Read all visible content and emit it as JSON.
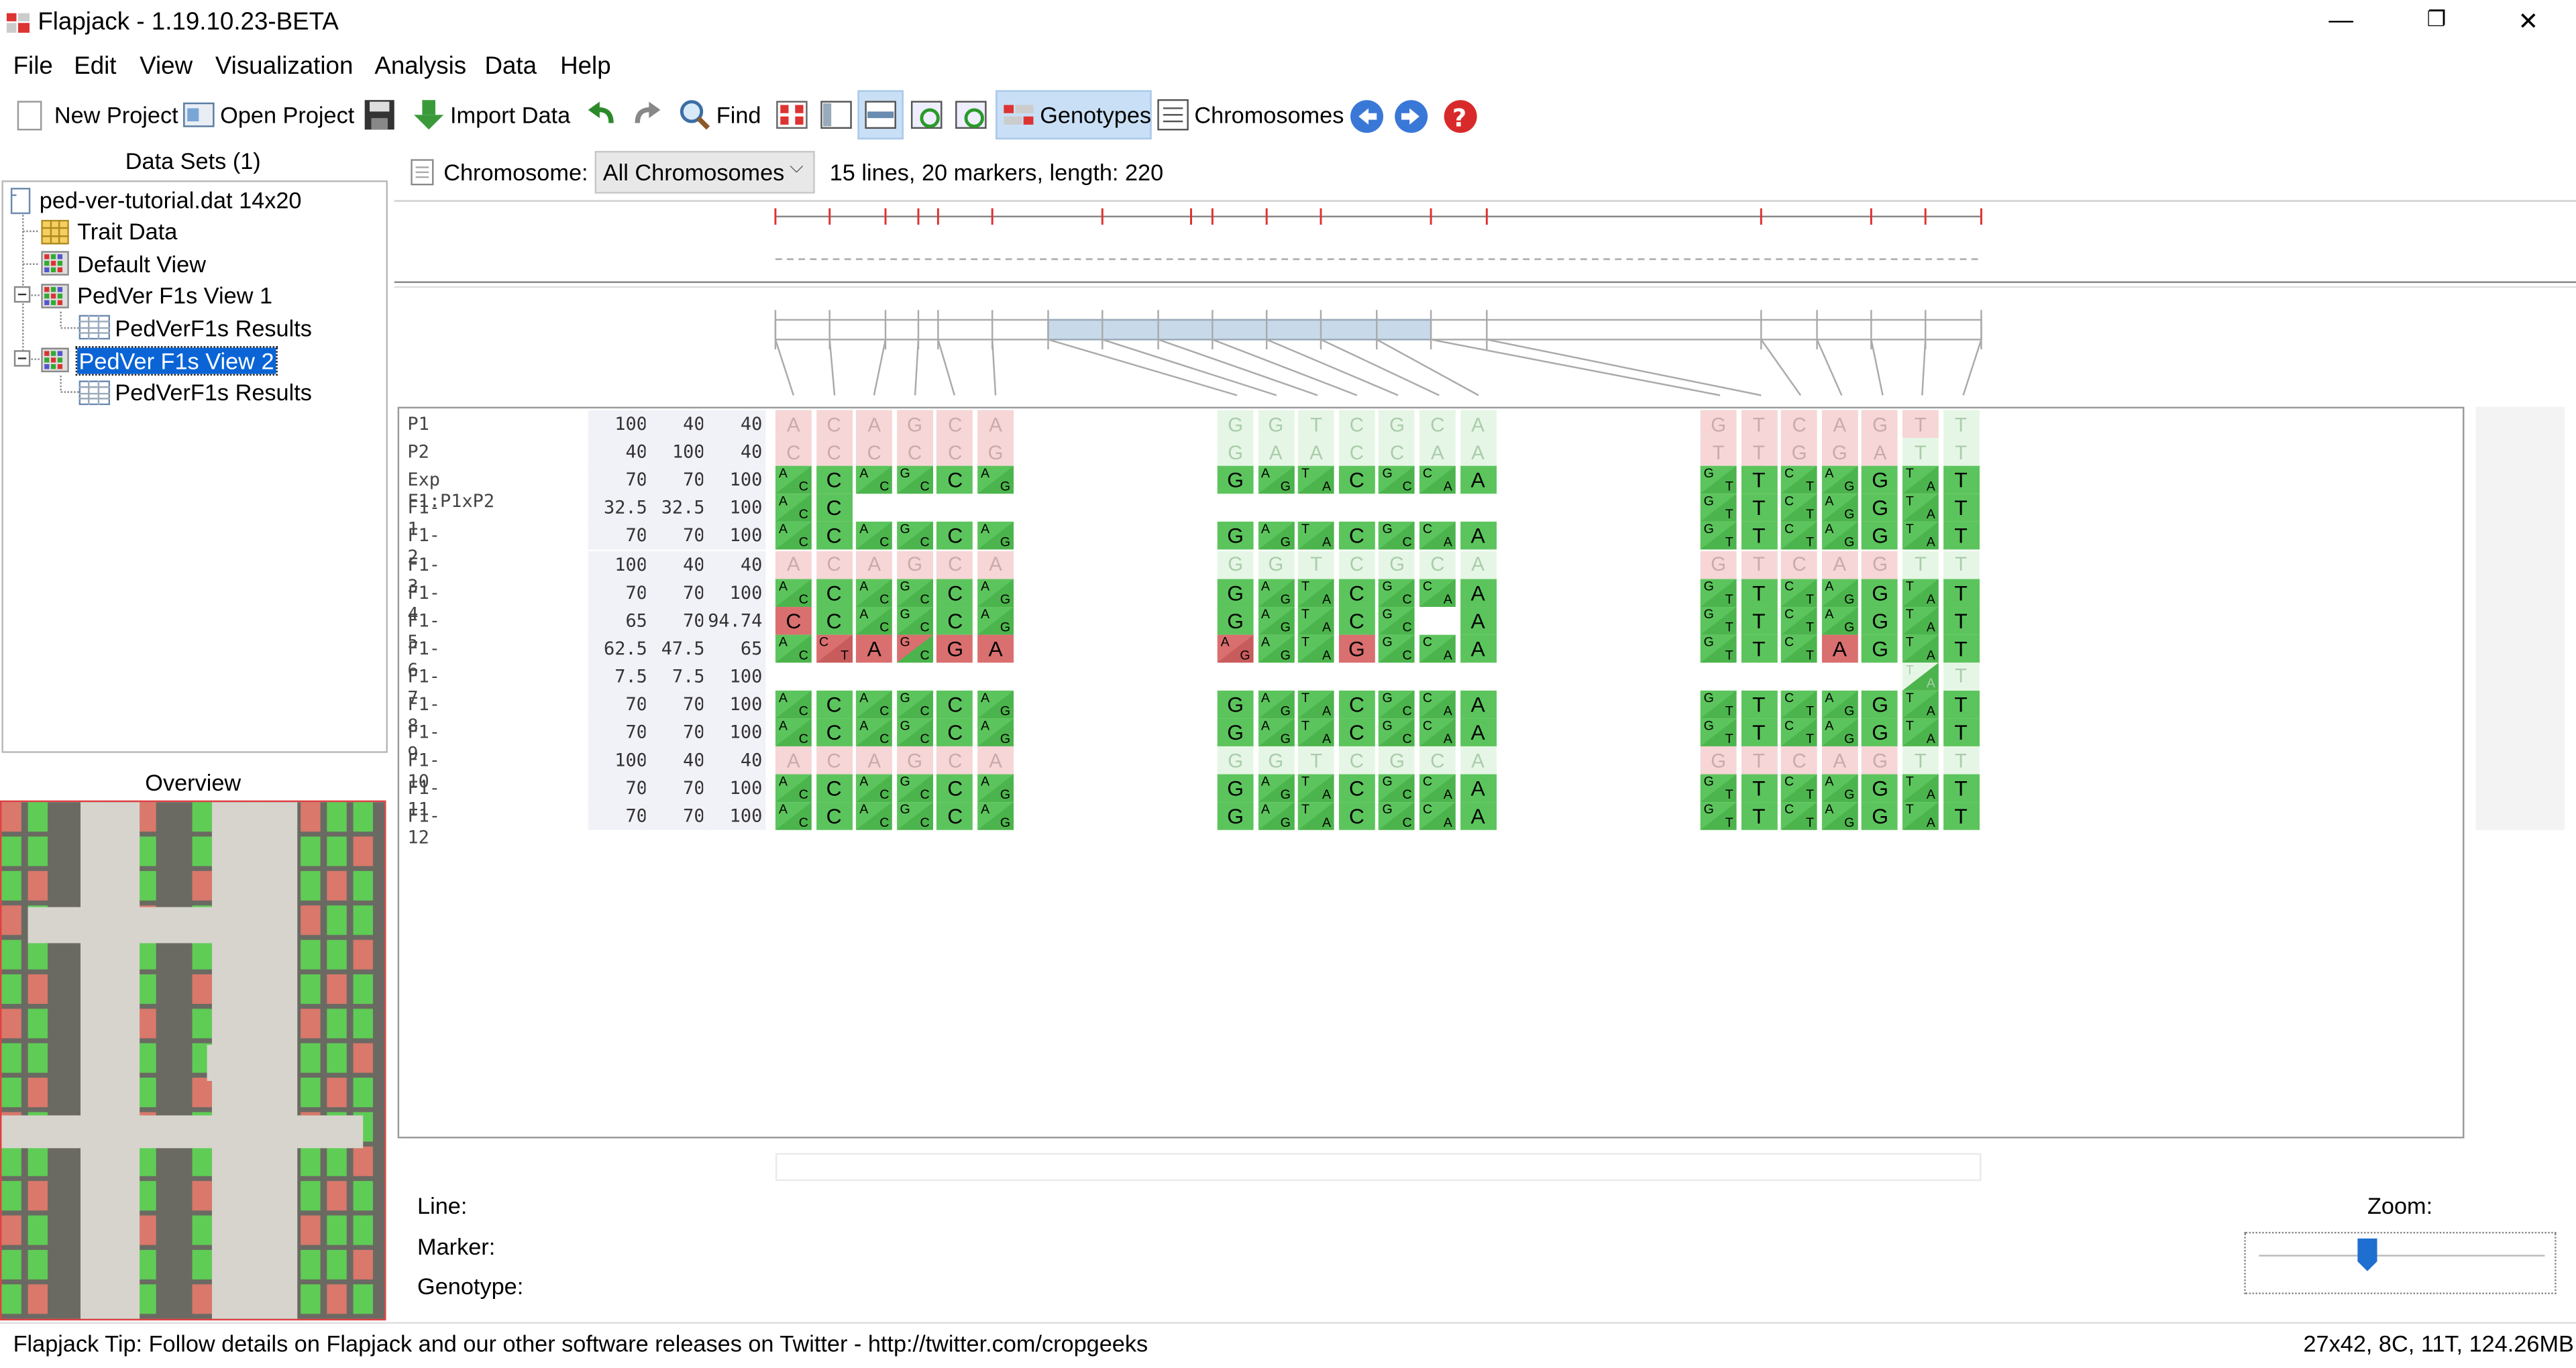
{
  "window": {
    "title": "Flapjack - 1.19.10.23-BETA",
    "minimize": "—",
    "restore": "❐",
    "close": "✕"
  },
  "menu": [
    "File",
    "Edit",
    "View",
    "Visualization",
    "Analysis",
    "Data",
    "Help"
  ],
  "toolbar": {
    "new_project": "New Project",
    "open_project": "Open Project",
    "import_data": "Import Data",
    "find": "Find",
    "genotypes": "Genotypes",
    "chromosomes": "Chromosomes"
  },
  "datasets": {
    "header": "Data Sets (1)",
    "items": [
      {
        "label": "ped-ver-tutorial.dat 14x20",
        "level": 0,
        "icon": "document-icon"
      },
      {
        "label": "Trait Data",
        "level": 1,
        "icon": "table-icon"
      },
      {
        "label": "Default View",
        "level": 1,
        "icon": "view-icon"
      },
      {
        "label": "PedVer F1s View 1",
        "level": 1,
        "icon": "view-icon"
      },
      {
        "label": "PedVerF1s Results",
        "level": 2,
        "icon": "results-icon"
      },
      {
        "label": "PedVer F1s View 2",
        "level": 1,
        "icon": "view-icon",
        "selected": true
      },
      {
        "label": "PedVerF1s Results",
        "level": 2,
        "icon": "results-icon"
      }
    ]
  },
  "overview": {
    "header": "Overview"
  },
  "chromosome_bar": {
    "label": "Chromosome:",
    "selected": "All Chromosomes",
    "summary": "15 lines, 20 markers, length: 220"
  },
  "genotype_table": {
    "rows": [
      {
        "name": "P1",
        "s1": "100",
        "s2": "40",
        "s3": "40"
      },
      {
        "name": "P2",
        "s1": "40",
        "s2": "100",
        "s3": "40"
      },
      {
        "name": "Exp F1:P1xP2",
        "s1": "70",
        "s2": "70",
        "s3": "100"
      },
      {
        "name": "F1-1",
        "s1": "32.5",
        "s2": "32.5",
        "s3": "100"
      },
      {
        "name": "F1-2",
        "s1": "70",
        "s2": "70",
        "s3": "100"
      },
      {
        "name": "F1-3",
        "s1": "100",
        "s2": "40",
        "s3": "40"
      },
      {
        "name": "F1-4",
        "s1": "70",
        "s2": "70",
        "s3": "100"
      },
      {
        "name": "F1-5",
        "s1": "65",
        "s2": "70",
        "s3": "94.74"
      },
      {
        "name": "F1-6",
        "s1": "62.5",
        "s2": "47.5",
        "s3": "65"
      },
      {
        "name": "F1-7",
        "s1": "7.5",
        "s2": "7.5",
        "s3": "100"
      },
      {
        "name": "F1-8",
        "s1": "70",
        "s2": "70",
        "s3": "100"
      },
      {
        "name": "F1-9",
        "s1": "70",
        "s2": "70",
        "s3": "100"
      },
      {
        "name": "F1-10",
        "s1": "100",
        "s2": "40",
        "s3": "40"
      },
      {
        "name": "F1-11",
        "s1": "70",
        "s2": "70",
        "s3": "100"
      },
      {
        "name": "F1-12",
        "s1": "70",
        "s2": "70",
        "s3": "100"
      }
    ],
    "p1": [
      "A",
      "C",
      "A",
      "G",
      "C",
      "A",
      "G",
      "G",
      "T",
      "C",
      "G",
      "C",
      "A",
      "G",
      "T",
      "C",
      "A",
      "G",
      "T",
      "T"
    ],
    "p2": [
      "C",
      "C",
      "C",
      "C",
      "C",
      "G",
      "G",
      "A",
      "A",
      "C",
      "C",
      "A",
      "A",
      "T",
      "T",
      "G",
      "G",
      "A",
      "T",
      "T"
    ]
  },
  "info": {
    "line": "Line:",
    "marker": "Marker:",
    "genotype": "Genotype:"
  },
  "zoom": {
    "label": "Zoom:",
    "value": 0.38
  },
  "status": {
    "tip": "Flapjack Tip:  Follow details on Flapjack and our other software releases on Twitter - http://twitter.com/cropgeeks",
    "memory": "27x42, 8C, 11T, 124.26MB"
  },
  "colors": {
    "green": "#5cc45c",
    "light_green": "#c6ecc6",
    "pale_green": "#e6f6e6",
    "red": "#d96f6f",
    "pale_red": "#f6d6d6",
    "selected": "#0a64d6",
    "overview_red": "#d9786b",
    "overview_green": "#5fcc55",
    "overview_grey": "#d6d4cc"
  }
}
